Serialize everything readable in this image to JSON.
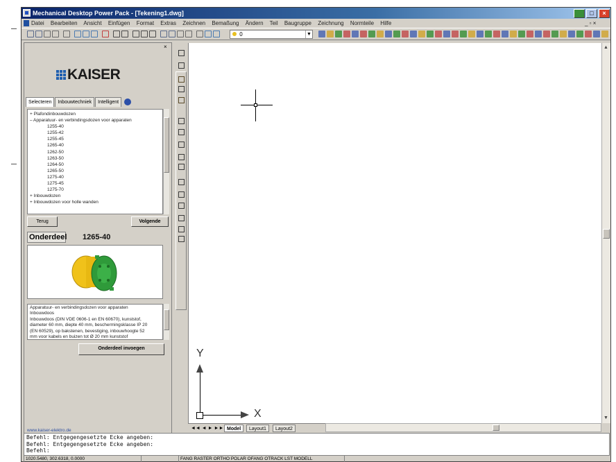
{
  "window": {
    "title": "Mechanical Desktop Power Pack - [Tekening1.dwg]",
    "controls": {
      "min": "_",
      "max": "□",
      "close": "×"
    }
  },
  "menubar": [
    "Datei",
    "Bearbeiten",
    "Ansicht",
    "Einfügen",
    "Format",
    "Extras",
    "Zeichnen",
    "Bemaßung",
    "Ändern",
    "Teil",
    "Baugruppe",
    "Zeichnung",
    "Normteile",
    "Hilfe"
  ],
  "menubar_right": "_ ▫ ×",
  "toolbar": {
    "layer_value": "0"
  },
  "left_panel": {
    "logo_text": "KAISER",
    "tabs": [
      "Selecteren",
      "Inbouwtechniek",
      "Intelligent"
    ],
    "tree": [
      {
        "level": 1,
        "text": "+ Plafondinbouwdozen"
      },
      {
        "level": 1,
        "text": "– Apparatuur- en verbindingsdozen voor apparaten"
      },
      {
        "level": 2,
        "text": "1255-40"
      },
      {
        "level": 2,
        "text": "1255-42"
      },
      {
        "level": 2,
        "text": "1255-45"
      },
      {
        "level": 2,
        "text": "1265-40"
      },
      {
        "level": 2,
        "text": "1262-50"
      },
      {
        "level": 2,
        "text": "1263-50"
      },
      {
        "level": 2,
        "text": "1264-50"
      },
      {
        "level": 2,
        "text": "1265-50"
      },
      {
        "level": 2,
        "text": "1275-40"
      },
      {
        "level": 2,
        "text": "1275-45"
      },
      {
        "level": 2,
        "text": "1275-70"
      },
      {
        "level": 1,
        "text": "+ Inbouwdozen"
      },
      {
        "level": 1,
        "text": "+ Inbouwdozen voor holle wanden"
      }
    ],
    "back_button": "Terug",
    "next_button": "Volgende",
    "part_label": "Onderdeel",
    "part_number": "1265-40",
    "description": [
      "Apparatuur- en verbindingsdozen voor apparaten",
      "Inbouwdoos",
      "Inbouwdoos (DIN VDE 0606-1 en EN 60670), kunststof,",
      "diameter 60 mm, diepte 40 mm, beschermingsklasse IP 20",
      "(EN 60529), op bakstenen, bevestiging, inbouwhoogte 52",
      "mm voor kabels en buizen tot Ø 20 mm kunststof"
    ],
    "insert_button": "Onderdeel invoegen",
    "site_link": "www.kaiser-elektro.de"
  },
  "canvas": {
    "ucs_x": "X",
    "ucs_y": "Y"
  },
  "layout_tabs": [
    "Model",
    "Layout1",
    "Layout2"
  ],
  "command_lines": [
    "Befehl:  Entgegengesetzte Ecke angeben:",
    "Befehl:  Entgegengesetzte Ecke angeben:",
    "Befehl:"
  ],
  "statusbar": {
    "coords": "1020.5480, 302.6318, 0.0000",
    "modes": "FANG RASTER ORTHO POLAR OFANG OTRACK LST MODELL"
  },
  "colors": {
    "title_start": "#0a246a",
    "title_end": "#a6caf0",
    "chrome": "#d4d0c8",
    "part_yellow": "#f0c21a",
    "part_green": "#2f9a3a"
  }
}
